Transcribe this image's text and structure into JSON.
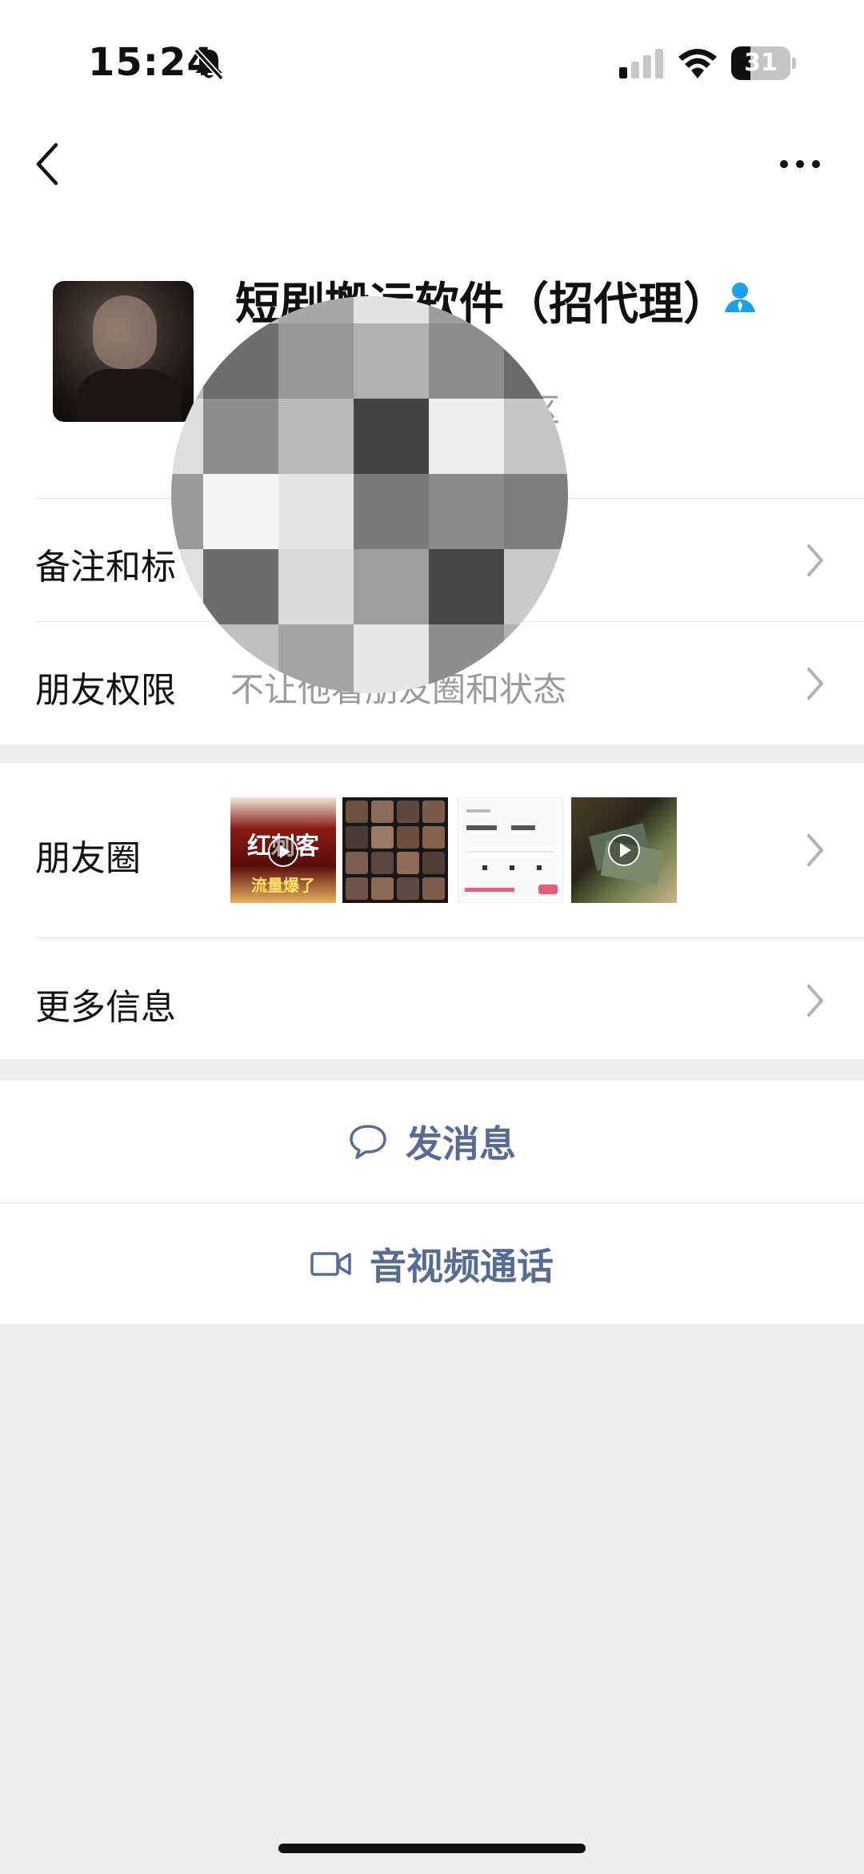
{
  "status_bar": {
    "time": "15:24",
    "battery": "31"
  },
  "profile": {
    "name": "短剧搬运软件（招代理）",
    "sub_fragment": "区"
  },
  "rows": {
    "remark": {
      "label": "备注和标"
    },
    "permissions": {
      "label": "朋友权限",
      "value": "不让他看朋友圈和状态"
    },
    "moments": {
      "label": "朋友圈",
      "thumb1_text_top": "红刺客",
      "thumb1_text_bottom": "流量爆了"
    },
    "more_info": {
      "label": "更多信息"
    }
  },
  "actions": {
    "message": "发消息",
    "call": "音视频通话"
  },
  "colors": {
    "accent": "#576b95",
    "badge": "#1aa0f0",
    "background": "#ededed"
  },
  "icons": [
    "bell-muted-icon",
    "signal-icon",
    "wifi-icon",
    "battery-icon",
    "back-chevron-icon",
    "more-icon",
    "contact-badge-icon",
    "chevron-right-icon",
    "chat-bubble-icon",
    "video-camera-icon",
    "play-icon"
  ]
}
